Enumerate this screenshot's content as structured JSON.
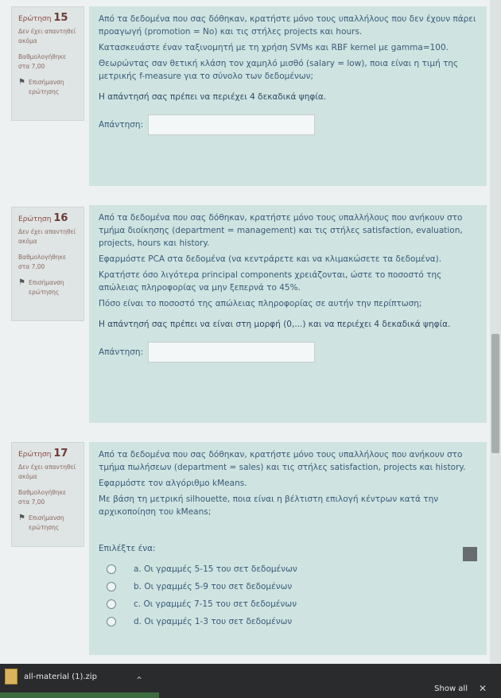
{
  "q15": {
    "number_label": "Ερώτηση",
    "number": "15",
    "status": "Δεν έχει απαντηθεί ακόμα",
    "grade": "Βαθμολογήθηκε στα 7,00",
    "flag": "Επισήμανση ερώτησης",
    "lines": [
      "Από τα δεδομένα που σας δόθηκαν, κρατήστε μόνο τους υπαλλήλους που δεν έχουν πάρει προαγωγή (promotion = No) και τις στήλες projects και hours.",
      "Κατασκευάστε έναν ταξινομητή με τη χρήση SVMs και RBF kernel με gamma=100.",
      "Θεωρώντας σαν θετική κλάση τον χαμηλό μισθό (salary = low), ποια είναι η τιμή της μετρικής f-measure για το σύνολο των δεδομένων;"
    ],
    "requirement": "Η απάντησή σας πρέπει να περιέχει 4 δεκαδικά ψηφία.",
    "answer_label": "Απάντηση:"
  },
  "q16": {
    "number_label": "Ερώτηση",
    "number": "16",
    "status": "Δεν έχει απαντηθεί ακόμα",
    "grade": "Βαθμολογήθηκε στα 7,00",
    "flag": "Επισήμανση ερώτησης",
    "lines": [
      "Από τα δεδομένα που σας δόθηκαν, κρατήστε μόνο τους υπαλλήλους που ανήκουν στο τμήμα διοίκησης (department = management) και τις στήλες satisfaction, evaluation, projects, hours και history.",
      "Εφαρμόστε PCA στα δεδομένα (να κεντράρετε και να κλιμακώσετε τα δεδομένα).",
      "Κρατήστε όσο λιγότερα principal components χρειάζονται, ώστε το ποσοστό της απώλειας πληροφορίας να μην ξεπερνά το 45%.",
      "Πόσο είναι το ποσοστό της απώλειας πληροφορίας σε αυτήν την περίπτωση;"
    ],
    "requirement": "Η απάντησή σας πρέπει να είναι στη μορφή (0,...) και να περιέχει 4 δεκαδικά ψηφία.",
    "answer_label": "Απάντηση:"
  },
  "q17": {
    "number_label": "Ερώτηση",
    "number": "17",
    "status": "Δεν έχει απαντηθεί ακόμα",
    "grade": "Βαθμολογήθηκε στα 7,00",
    "flag": "Επισήμανση ερώτησης",
    "lines": [
      "Από τα δεδομένα που σας δόθηκαν, κρατήστε μόνο τους υπαλλήλους που ανήκουν στο τμήμα πωλήσεων (department = sales) και τις στήλες satisfaction, projects και history.",
      "Εφαρμόστε τον αλγόριθμο kMeans.",
      "Με βάση τη μετρική silhouette, ποια είναι η βέλτιστη επιλογή κέντρων κατά την αρχικοποίηση του kMeans;"
    ],
    "prompt": "Επιλέξτε ένα:",
    "options": [
      "a. Οι γραμμές 5-15 του σετ δεδομένων",
      "b. Οι γραμμές 5-9 του σετ δεδομένων",
      "c. Οι γραμμές 7-15 του σετ δεδομένων",
      "d. Οι γραμμές 1-3 του σετ δεδομένων"
    ]
  },
  "taskbar": {
    "download_name": "all-material (1).zip",
    "show_all": "Show all"
  }
}
